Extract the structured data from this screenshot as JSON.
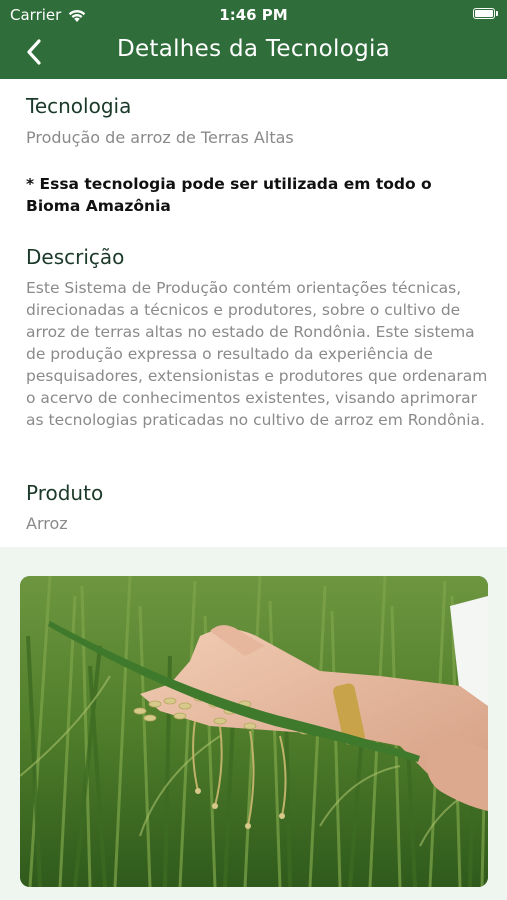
{
  "status_bar": {
    "carrier": "Carrier",
    "time": "1:46 PM",
    "wifi_icon": "wifi-icon",
    "battery_icon": "battery-icon"
  },
  "nav": {
    "title": "Detalhes da Tecnologia",
    "back_icon": "chevron-left-icon",
    "background_color": "#2f6e3a"
  },
  "tecnologia": {
    "heading": "Tecnologia",
    "value": "Produção de arroz de Terras Altas"
  },
  "notice": "* Essa tecnologia pode ser utilizada em todo o Bioma Amazônia",
  "descricao": {
    "heading": "Descrição",
    "text": "Este Sistema de Produção contém orientações técnicas, direcionadas a técnicos e produtores, sobre o cultivo de arroz de terras altas no estado de Rondônia. Este sistema de produção expressa o resultado da experiência de pesquisadores, extensionistas e produtores que ordenaram o acervo de conhecimentos existentes, visando aprimorar as tecnologias praticadas no cultivo de arroz em Rondônia."
  },
  "produto": {
    "heading": "Produto",
    "value": "Arroz"
  },
  "image": {
    "subject": "hands holding rice panicle in a green rice field"
  }
}
